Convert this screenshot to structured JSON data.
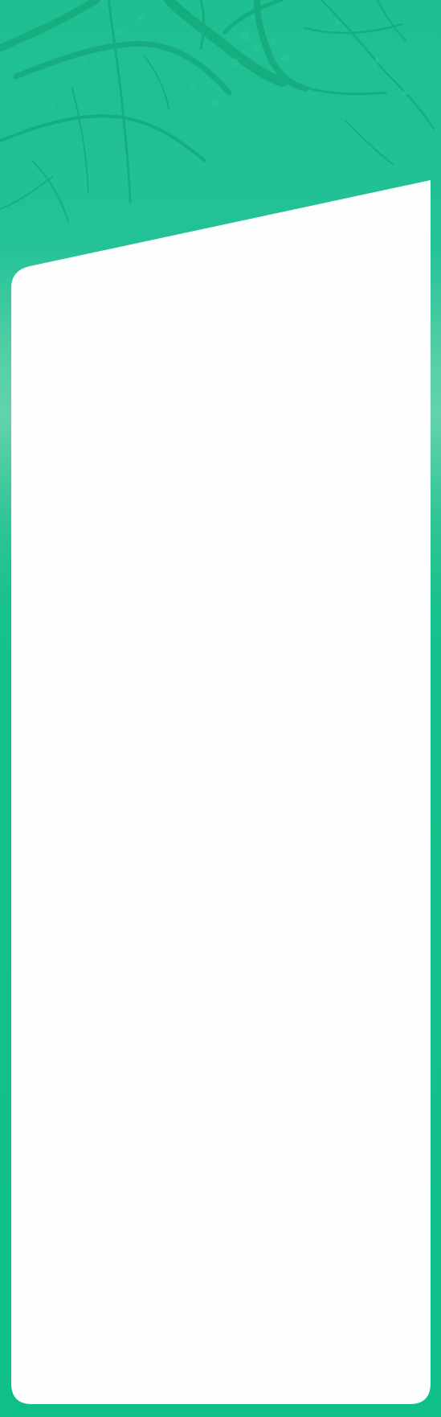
{
  "background": {
    "image_icon": "tree-branches-illustration",
    "primary_color": "#0fbf8a",
    "secondary_color": "#62d2ad",
    "panel_color": "#fefefe"
  }
}
